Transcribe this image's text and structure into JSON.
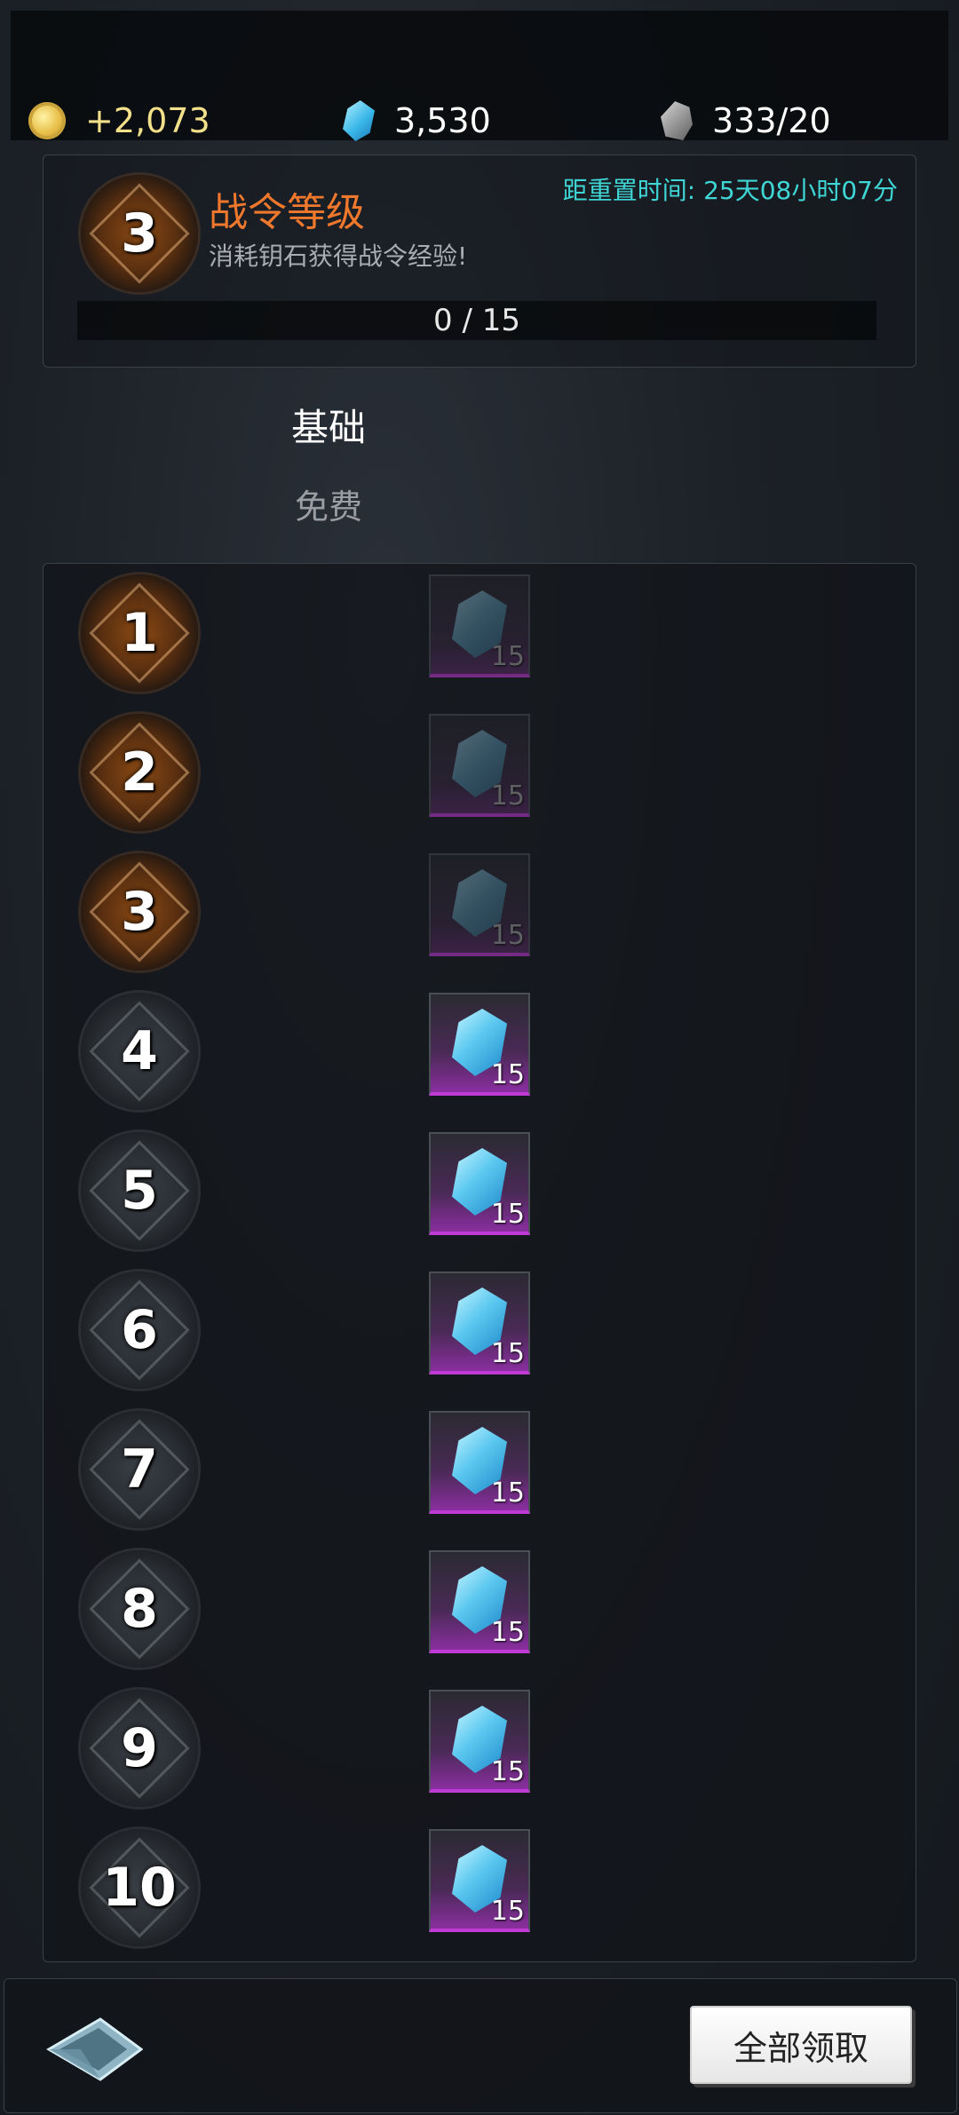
{
  "resources": {
    "gold": "+2,073",
    "gems": "3,530",
    "stone": "333/20"
  },
  "level_panel": {
    "level": "3",
    "title": "战令等级",
    "description": "消耗钥石获得战令经验!",
    "reset_label": "距重置时间: 25天08小时07分",
    "exp_text": "0 / 15"
  },
  "tier": {
    "name": "基础",
    "sub": "免费"
  },
  "rows": [
    {
      "level": "1",
      "qty": "15",
      "state": "claimed"
    },
    {
      "level": "2",
      "qty": "15",
      "state": "claimed"
    },
    {
      "level": "3",
      "qty": "15",
      "state": "claimed"
    },
    {
      "level": "4",
      "qty": "15",
      "state": "locked"
    },
    {
      "level": "5",
      "qty": "15",
      "state": "locked"
    },
    {
      "level": "6",
      "qty": "15",
      "state": "locked"
    },
    {
      "level": "7",
      "qty": "15",
      "state": "locked"
    },
    {
      "level": "8",
      "qty": "15",
      "state": "locked"
    },
    {
      "level": "9",
      "qty": "15",
      "state": "locked"
    },
    {
      "level": "10",
      "qty": "15",
      "state": "locked"
    }
  ],
  "bottom": {
    "claim_all": "全部领取"
  },
  "icons": {
    "gold": "gold-coin-icon",
    "gem": "blue-gem-icon",
    "stone": "key-stone-icon",
    "back": "back-arrow-icon"
  },
  "colors": {
    "title_orange": "#f0782c",
    "reset_cyan": "#3fd6d6",
    "reward_purple": "#c03ad6"
  }
}
